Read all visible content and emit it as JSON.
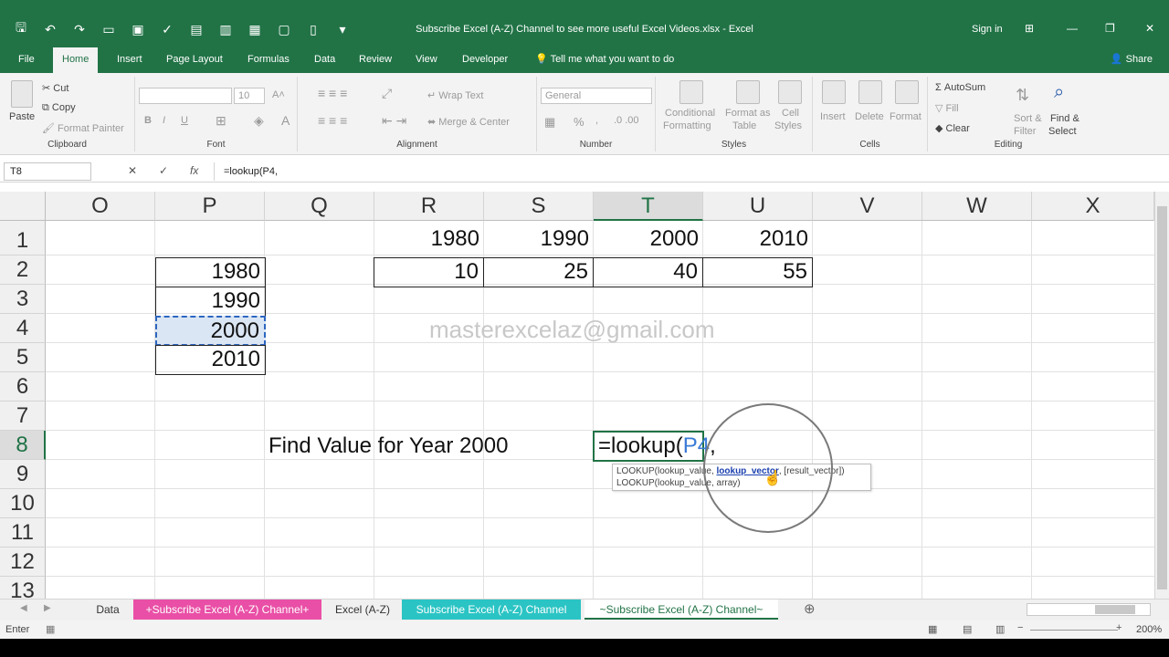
{
  "window": {
    "title": "Subscribe Excel (A-Z) Channel to see more useful Excel Videos.xlsx - Excel",
    "signin": "Sign in",
    "controls": [
      "⊞",
      "—",
      "❐",
      "✕"
    ]
  },
  "ribbon_tabs": [
    "File",
    "Home",
    "Insert",
    "Page Layout",
    "Formulas",
    "Data",
    "Review",
    "View",
    "Developer"
  ],
  "tell_me": "Tell me what you want to do",
  "share": "Share",
  "ribbon": {
    "clipboard": {
      "paste": "Paste",
      "cut": "Cut",
      "copy": "Copy",
      "format_painter": "Format Painter",
      "label": "Clipboard"
    },
    "font": {
      "size": "10",
      "label": "Font",
      "bold": "B",
      "italic": "I",
      "underline": "U"
    },
    "alignment": {
      "wrap": "Wrap Text",
      "merge": "Merge & Center",
      "label": "Alignment"
    },
    "number": {
      "format": "General",
      "label": "Number",
      "percent": "%"
    },
    "styles": {
      "conditional": "Conditional",
      "formatting": "Formatting",
      "format_as": "Format as",
      "table": "Table",
      "cell": "Cell",
      "styles": "Styles",
      "label": "Styles"
    },
    "cells": {
      "insert": "Insert",
      "delete": "Delete",
      "format": "Format",
      "label": "Cells"
    },
    "editing": {
      "autosum": "AutoSum",
      "fill": "Fill",
      "clear": "Clear",
      "sort": "Sort &",
      "filter": "Filter",
      "find": "Find &",
      "select": "Select",
      "label": "Editing"
    }
  },
  "formula_bar": {
    "name_box": "T8",
    "formula": "=lookup(P4,"
  },
  "grid": {
    "columns": [
      "O",
      "P",
      "Q",
      "R",
      "S",
      "T",
      "U",
      "V",
      "W",
      "X"
    ],
    "rows": [
      "1",
      "2",
      "3",
      "4",
      "5",
      "6",
      "7",
      "8",
      "9",
      "10",
      "11",
      "12",
      "13"
    ],
    "row1": [
      "1980",
      "1990",
      "2000",
      "2010"
    ],
    "row2": [
      "10",
      "25",
      "40",
      "55"
    ],
    "p_col": [
      "1980",
      "1990",
      "2000",
      "2010"
    ],
    "label_q8": "Find Value for Year 2000",
    "edit_prefix": "=lookup(",
    "edit_ref": "P4",
    "edit_suffix": ",",
    "watermark": "masterexcelaz@gmail.com",
    "tooltip": {
      "line1_a": "LOOKUP(lookup_value, ",
      "line1_b": "lookup_vector",
      "line1_c": ", [result_vector])",
      "line2": "LOOKUP(lookup_value, array)"
    }
  },
  "sheets": [
    "Data",
    "+Subscribe Excel (A-Z) Channel+",
    "Excel (A-Z)",
    "Subscribe Excel (A-Z) Channel",
    "~Subscribe Excel (A-Z) Channel~"
  ],
  "status": {
    "mode": "Enter",
    "zoom": "200%"
  }
}
